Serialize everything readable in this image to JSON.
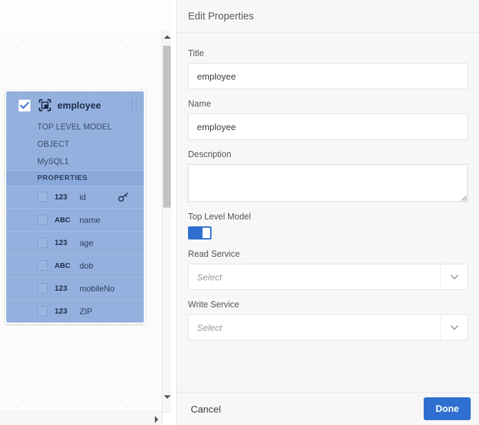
{
  "canvas": {
    "card": {
      "checkbox_checked": true,
      "icon": "model-object-icon",
      "title": "employee",
      "subtitle": "TOP LEVEL MODEL OBJECT",
      "datasource": "MySQL1",
      "section_label": "PROPERTIES",
      "properties": [
        {
          "type": "123",
          "name": "id",
          "checked": false,
          "primary_key": true
        },
        {
          "type": "ABC",
          "name": "name",
          "checked": false,
          "primary_key": false
        },
        {
          "type": "123",
          "name": "age",
          "checked": false,
          "primary_key": false
        },
        {
          "type": "ABC",
          "name": "dob",
          "checked": false,
          "primary_key": false
        },
        {
          "type": "123",
          "name": "mobileNo",
          "checked": false,
          "primary_key": false
        },
        {
          "type": "123",
          "name": "ZIP",
          "checked": false,
          "primary_key": false
        }
      ]
    },
    "scrollbars": {
      "vertical_up_icon": "triangle-up-icon",
      "vertical_down_icon": "triangle-down-icon",
      "horizontal_right_icon": "triangle-right-icon"
    }
  },
  "panel": {
    "header": {
      "title": "Edit Properties"
    },
    "fields": {
      "title": {
        "label": "Title",
        "value": "employee"
      },
      "name": {
        "label": "Name",
        "value": "employee"
      },
      "description": {
        "label": "Description",
        "value": ""
      },
      "top_level_model": {
        "label": "Top Level Model",
        "enabled": true
      },
      "read_service": {
        "label": "Read Service",
        "value": "",
        "placeholder": "Select",
        "chevron_icon": "chevron-down-icon"
      },
      "write_service": {
        "label": "Write Service",
        "value": "",
        "placeholder": "Select",
        "chevron_icon": "chevron-down-icon"
      }
    },
    "footer": {
      "cancel_label": "Cancel",
      "done_label": "Done",
      "done_color": "#2f6fd0"
    }
  }
}
